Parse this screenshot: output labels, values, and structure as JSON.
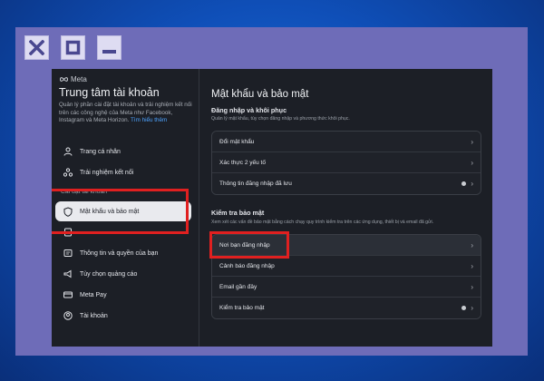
{
  "colors": {
    "highlight": "#e02020",
    "link": "#4da3ff",
    "frame": "#6e6cb8",
    "panel": "#1c1f26"
  },
  "window_buttons": [
    "close-icon",
    "maximize-icon",
    "minimize-icon"
  ],
  "sidebar": {
    "brand": "Meta",
    "title": "Trung tâm tài khoản",
    "description": "Quản lý phần cài đặt tài khoản và trải nghiệm kết nối trên các công nghệ của Meta như Facebook, Instagram và Meta Horizon.",
    "learn_more": "Tìm hiểu thêm",
    "top_items": [
      {
        "label": "Trang cá nhân",
        "icon": "person-icon"
      },
      {
        "label": "Trải nghiệm kết nối",
        "icon": "connected-icon"
      }
    ],
    "section_label": "Cài đặt tài khoản",
    "items": [
      {
        "label": "Mật khẩu và bảo mật",
        "icon": "shield-icon",
        "active": true
      },
      {
        "label": "",
        "icon": "document-icon"
      },
      {
        "label": "Thông tin và quyền của bạn",
        "icon": "info-icon"
      },
      {
        "label": "Tùy chọn quảng cáo",
        "icon": "megaphone-icon"
      },
      {
        "label": "Meta Pay",
        "icon": "card-icon"
      },
      {
        "label": "Tài khoản",
        "icon": "account-icon"
      }
    ]
  },
  "main": {
    "title": "Mật khẩu và bảo mật",
    "login_section": {
      "title": "Đăng nhập và khôi phục",
      "description": "Quản lý mật khẩu, tùy chọn đăng nhập và phương thức khôi phục.",
      "rows": [
        {
          "label": "Đổi mật khẩu"
        },
        {
          "label": "Xác thực 2 yếu tố"
        },
        {
          "label": "Thông tin đăng nhập đã lưu"
        }
      ]
    },
    "security_section": {
      "title": "Kiểm tra bảo mật",
      "description": "Xem xét các vấn đề bảo mật bằng cách chạy quy trình kiểm tra trên các ứng dụng, thiết bị và email đã gửi.",
      "rows": [
        {
          "label": "Nơi bạn đăng nhập"
        },
        {
          "label": "Cảnh báo đăng nhập"
        },
        {
          "label": "Email gần đây"
        },
        {
          "label": "Kiểm tra bảo mật"
        }
      ]
    }
  }
}
